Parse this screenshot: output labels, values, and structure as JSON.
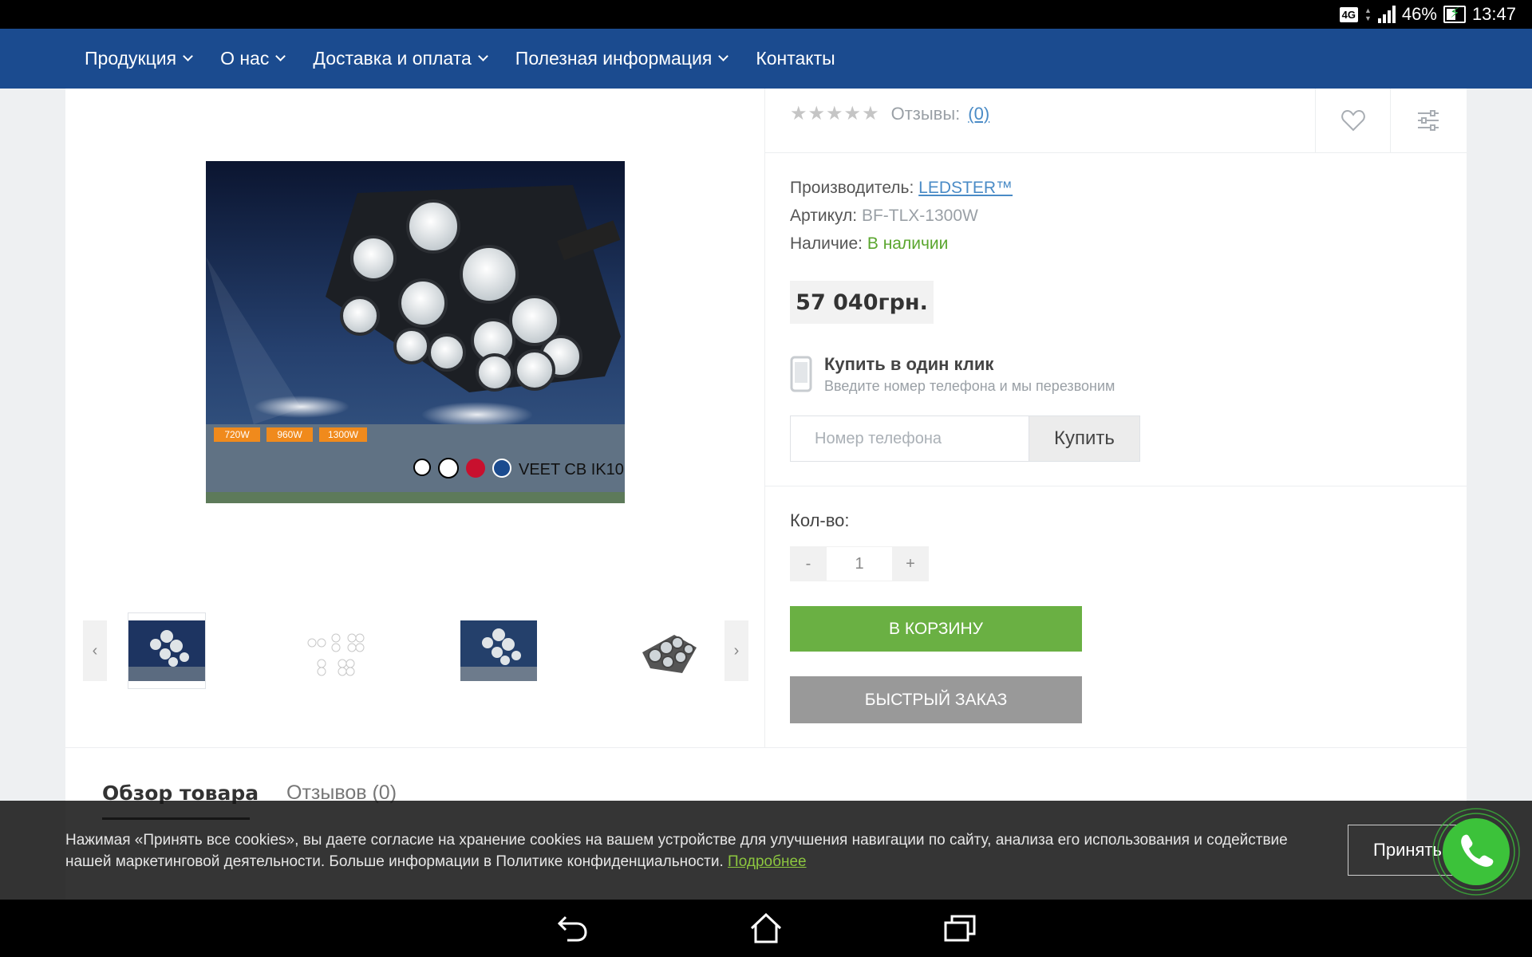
{
  "status_bar": {
    "network": "4G",
    "battery": "46%",
    "time": "13:47"
  },
  "nav": {
    "items": [
      {
        "label": "Продукция",
        "dropdown": true
      },
      {
        "label": "О нас",
        "dropdown": true
      },
      {
        "label": "Доставка и оплата",
        "dropdown": true
      },
      {
        "label": "Полезная информация",
        "dropdown": true
      },
      {
        "label": "Контакты",
        "dropdown": false
      }
    ]
  },
  "product": {
    "image_badges": [
      "720W",
      "960W",
      "1300W"
    ],
    "image_certs": "VEET CB IK10",
    "rating": {
      "stars": 0,
      "max": 5
    },
    "reviews_label": "Отзывы:",
    "reviews_count": "(0)",
    "manufacturer_label": "Производитель:",
    "manufacturer": "LEDSTER™",
    "sku_label": "Артикул:",
    "sku": "BF-TLX-1300W",
    "availability_label": "Наличие:",
    "availability": "В наличии",
    "price": "57 040грн.",
    "one_click_title": "Купить в один клик",
    "one_click_subtitle": "Введите номер телефона и мы перезвоним",
    "phone_placeholder": "Номер телефона",
    "buy_button": "Купить",
    "qty_label": "Кол-во:",
    "qty_minus": "-",
    "qty_value": "1",
    "qty_plus": "+",
    "cart_button": "В КОРЗИНУ",
    "quick_order_button": "БЫСТРЫЙ ЗАКАЗ",
    "thumb_prev": "‹",
    "thumb_next": "›"
  },
  "tabs": [
    {
      "label": "Обзор товара",
      "active": true
    },
    {
      "label": "Отзывов (0)",
      "active": false
    }
  ],
  "cookie": {
    "text": "Нажимая «Принять все cookies», вы даете согласие на хранение cookies на вашем устройстве для улучшения навигации по сайту, анализа его использования и содействие нашей маркетинговой деятельности. Больше информации в Политике конфиденциальности.",
    "more_link": "Подробнее",
    "accept_button": "Принять"
  },
  "colors": {
    "nav_bg": "#1b4b8f",
    "cart_green": "#6ab043",
    "availability_green": "#5aa62e",
    "link_blue": "#4a8bc6",
    "call_green": "#3cc23a"
  },
  "icons": [
    "heart-icon",
    "compare-icon",
    "mobile-phone-icon",
    "phone-call-icon",
    "back-icon",
    "home-icon",
    "recent-apps-icon"
  ]
}
